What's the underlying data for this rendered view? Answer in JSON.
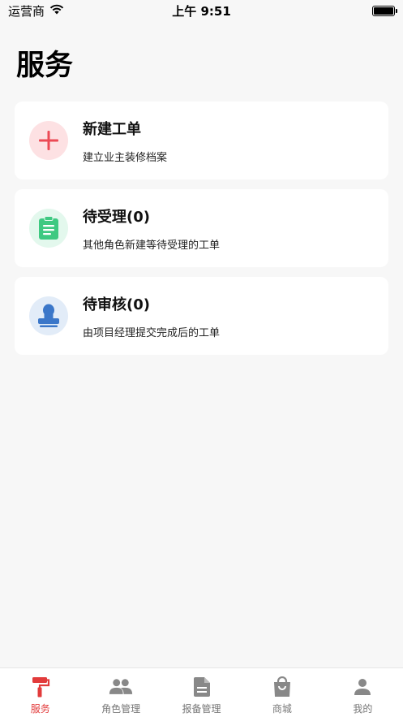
{
  "status_bar": {
    "carrier": "运营商",
    "time": "上午 9:51"
  },
  "page": {
    "title": "服务"
  },
  "cards": [
    {
      "title": "新建工单",
      "description": "建立业主装修档案",
      "icon": "plus-icon",
      "icon_bg": "#fde1e3",
      "icon_color": "#ec4a55"
    },
    {
      "title": "待受理(0)",
      "description": "其他角色新建等待受理的工单",
      "icon": "clipboard-icon",
      "icon_bg": "#e3f8ed",
      "icon_color": "#3ec981"
    },
    {
      "title": "待审核(0)",
      "description": "由项目经理提交完成后的工单",
      "icon": "stamp-icon",
      "icon_bg": "#e2ecf8",
      "icon_color": "#3b77c9"
    }
  ],
  "tab_bar": {
    "active_color": "#e23b3b",
    "items": [
      {
        "label": "服务",
        "icon": "paint-roller-icon",
        "active": true
      },
      {
        "label": "角色管理",
        "icon": "people-icon",
        "active": false
      },
      {
        "label": "报备管理",
        "icon": "document-icon",
        "active": false
      },
      {
        "label": "商城",
        "icon": "shopping-bag-icon",
        "active": false
      },
      {
        "label": "我的",
        "icon": "person-icon",
        "active": false
      }
    ]
  }
}
